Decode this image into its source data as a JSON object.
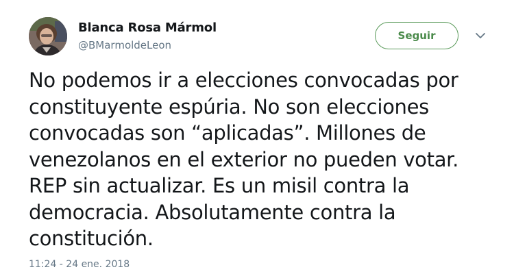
{
  "author": {
    "display_name": "Blanca Rosa Mármol",
    "handle": "@BMarmoldeLeon",
    "avatar_icon": "profile-photo"
  },
  "actions": {
    "follow_label": "Seguir",
    "menu_icon": "chevron-down-icon"
  },
  "tweet": {
    "lines": [
      "No podemos ir a elecciones convocadas por",
      "constituyente espúria. No son elecciones",
      "convocadas son “aplicadas”. Millones de",
      "venezolanos en el exterior no pueden votar.",
      "REP sin actualizar. Es un misil contra la",
      "democracia. Absolutamente contra la",
      "constitución."
    ],
    "timestamp": "11:24 - 24 ene. 2018"
  },
  "colors": {
    "text": "#14171a",
    "secondary": "#657786",
    "follow_border": "#5a9a5a"
  }
}
